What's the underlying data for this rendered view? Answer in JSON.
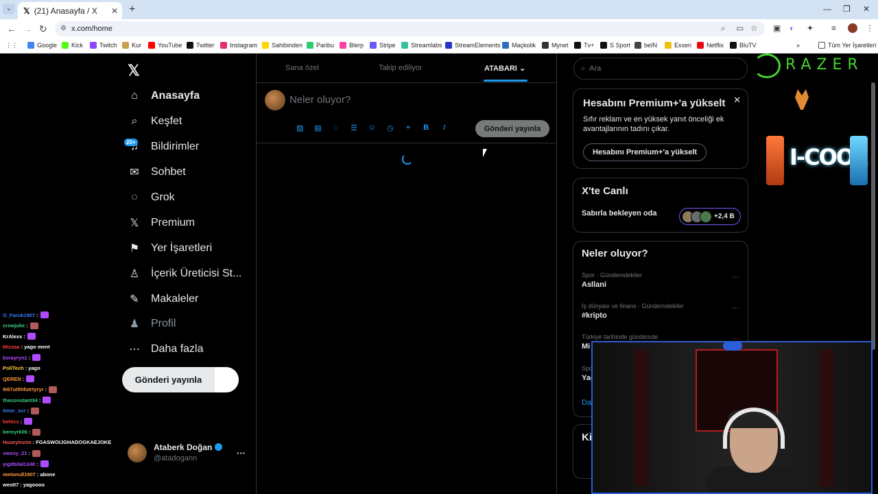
{
  "browser": {
    "tab_title": "(21) Anasayfa / X",
    "url": "x.com/home",
    "bookmarks": [
      "Google",
      "Kick",
      "Twitch",
      "Kur",
      "YouTube",
      "Twitter",
      "Instagram",
      "Sahibinden",
      "Paribu",
      "Blerp",
      "Stripe",
      "Streamlabs",
      "StreamElements",
      "Maçkolik",
      "Mynet",
      "Tv+",
      "S Sport",
      "beIN",
      "Exxen",
      "Netflix",
      "BluTV"
    ],
    "all_bookmarks": "Tüm Yer İşaretleri"
  },
  "sidebar": {
    "items": [
      {
        "label": "Anasayfa",
        "icon": "home-icon"
      },
      {
        "label": "Keşfet",
        "icon": "search-icon"
      },
      {
        "label": "Bildirimler",
        "icon": "bell-icon"
      },
      {
        "label": "Sohbet",
        "icon": "mail-icon"
      },
      {
        "label": "Grok",
        "icon": "grok-icon"
      },
      {
        "label": "Premium",
        "icon": "x-icon"
      },
      {
        "label": "Yer İşaretleri",
        "icon": "bookmark-icon"
      },
      {
        "label": "İçerik Üreticisi St...",
        "icon": "creator-icon"
      },
      {
        "label": "Makaleler",
        "icon": "article-icon"
      },
      {
        "label": "Profil",
        "icon": "person-icon"
      },
      {
        "label": "Daha fazla",
        "icon": "more-circle-icon"
      }
    ],
    "notif_badge": "20+",
    "post_button": "Gönderi yayınla",
    "account": {
      "name": "Ataberk Doğan",
      "handle": "@atadogann"
    }
  },
  "feed": {
    "tabs": [
      "Sana özel",
      "Takip ediliyor",
      "ATABARI"
    ],
    "composer_placeholder": "Neler oluyor?",
    "post_button": "Gönderi yayınla"
  },
  "right": {
    "search_placeholder": "Ara",
    "premium": {
      "title": "Hesabını Premium+'a yükselt",
      "body": "Sıfır reklam ve en yüksek yanıt önceliği ek avantajlarının tadını çıkar.",
      "button": "Hesabını Premium+'a yükselt"
    },
    "live": {
      "title": "X'te Canlı",
      "room": "Sabırla bekleyen oda",
      "count": "+2,4 B"
    },
    "trends": {
      "title": "Neler oluyor?",
      "items": [
        {
          "cat": "Spor · Gündemdekiler",
          "title": "Asllani"
        },
        {
          "cat": "İş dünyası ve finans · Gündemdekiler",
          "title": "#kripto"
        },
        {
          "cat": "Türkiye tarihinde gündemde",
          "title": "Mi"
        },
        {
          "cat": "Spo",
          "title": "Yağ"
        }
      ],
      "more": "Dah"
    },
    "who_title": "Kim"
  },
  "ad": {
    "brand": "RAZER",
    "product": "I-COOL"
  },
  "chat": [
    {
      "user": "O_Faruk1907",
      "msg": "",
      "color": "#3a7bff"
    },
    {
      "user": "crewjuke",
      "msg": "",
      "color": "#35d07f"
    },
    {
      "user": "KrAlexx",
      "msg": "",
      "color": "#ffffff"
    },
    {
      "user": "Mizsaa",
      "msg": "yago ment",
      "color": "#ff3a3a"
    },
    {
      "user": "korayryn1",
      "msg": "",
      "color": "#b04cff"
    },
    {
      "user": "PoliTech",
      "msg": "yago",
      "color": "#ffd23a"
    },
    {
      "user": "QEREN",
      "msg": "",
      "color": "#ff9a3a"
    },
    {
      "user": "9i67ut5hfutrtyryr",
      "msg": "",
      "color": "#ff9a3a"
    },
    {
      "user": "theconstant34",
      "msg": "",
      "color": "#35d07f"
    },
    {
      "user": "0mer_svr",
      "msg": "",
      "color": "#3a7bff"
    },
    {
      "user": "behicx",
      "msg": "",
      "color": "#ff3a3a"
    },
    {
      "user": "beroyrk06",
      "msg": "",
      "color": "#35d07f"
    },
    {
      "user": "Huseyinzim",
      "msg": "FGASWOIJGHADOGKAEJOKE",
      "color": "#ff5a5a"
    },
    {
      "user": "swoxy_21",
      "msg": "",
      "color": "#b04cff"
    },
    {
      "user": "yigitbilal1248",
      "msg": "",
      "color": "#b04cff"
    },
    {
      "user": "metonull1907",
      "msg": "abone",
      "color": "#ff9a3a"
    },
    {
      "user": "westt7",
      "msg": "yagoooo",
      "color": "#ffffff"
    }
  ]
}
